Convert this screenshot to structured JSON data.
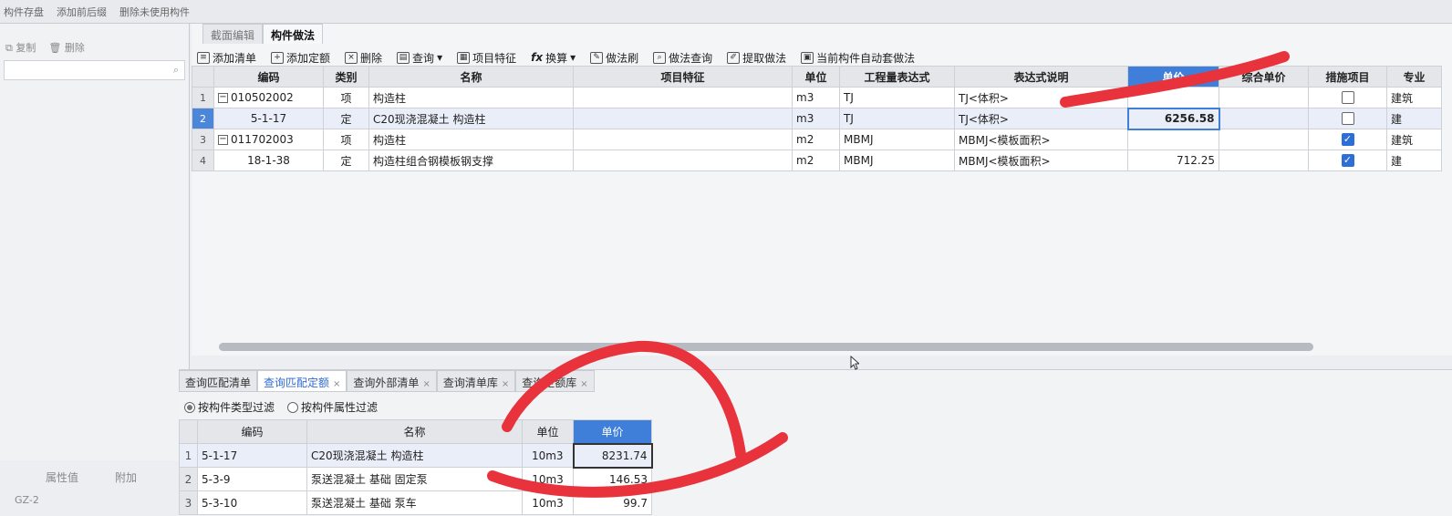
{
  "topbar": {
    "items": [
      "构件存盘",
      "添加前后缀",
      "删除未使用构件"
    ]
  },
  "left_panel": {
    "copy_label": "复制",
    "delete_label": "删除",
    "bottom_labels": [
      "属性值",
      "附加"
    ],
    "bottom_item": "GZ-2"
  },
  "editor": {
    "tabs": [
      "截面编辑",
      "构件做法"
    ],
    "toolbar": [
      "添加清单",
      "添加定额",
      "删除",
      "查询",
      "项目特征",
      "换算",
      "做法刷",
      "做法查询",
      "提取做法",
      "当前构件自动套做法"
    ],
    "columns": [
      "编码",
      "类别",
      "名称",
      "项目特征",
      "单位",
      "工程量表达式",
      "表达式说明",
      "单价",
      "综合单价",
      "措施项目",
      "专业"
    ],
    "rows": [
      {
        "num": "1",
        "code": "010502002",
        "type": "项",
        "name": "构造柱",
        "feature": "",
        "unit": "m3",
        "expr": "TJ",
        "desc": "TJ<体积>",
        "price": "",
        "comp": "",
        "measure": false,
        "major": "建筑"
      },
      {
        "num": "2",
        "code": "5-1-17",
        "type": "定",
        "name": "C20现浇混凝土 构造柱",
        "feature": "",
        "unit": "m3",
        "expr": "TJ",
        "desc": "TJ<体积>",
        "price": "6256.58",
        "comp": "",
        "measure": false,
        "major": "建"
      },
      {
        "num": "3",
        "code": "011702003",
        "type": "项",
        "name": "构造柱",
        "feature": "",
        "unit": "m2",
        "expr": "MBMJ",
        "desc": "MBMJ<模板面积>",
        "price": "",
        "comp": "",
        "measure": true,
        "major": "建筑"
      },
      {
        "num": "4",
        "code": "18-1-38",
        "type": "定",
        "name": "构造柱组合钢模板钢支撑",
        "feature": "",
        "unit": "m2",
        "expr": "MBMJ",
        "desc": "MBMJ<模板面积>",
        "price": "712.25",
        "comp": "",
        "measure": true,
        "major": "建"
      }
    ]
  },
  "bottom": {
    "tabs": [
      "查询匹配清单",
      "查询匹配定额",
      "查询外部清单",
      "查询清单库",
      "查询定额库"
    ],
    "filters": [
      "按构件类型过滤",
      "按构件属性过滤"
    ],
    "columns": [
      "编码",
      "名称",
      "单位",
      "单价"
    ],
    "rows": [
      {
        "num": "1",
        "code": "5-1-17",
        "name": "C20现浇混凝土 构造柱",
        "unit": "10m3",
        "price": "8231.74"
      },
      {
        "num": "2",
        "code": "5-3-9",
        "name": "泵送混凝土 基础 固定泵",
        "unit": "10m3",
        "price": "146.53"
      },
      {
        "num": "3",
        "code": "5-3-10",
        "name": "泵送混凝土 基础 泵车",
        "unit": "10m3",
        "price": "99.7"
      }
    ]
  },
  "colors": {
    "accent": "#3f7fd9",
    "annotation": "#e8323c"
  }
}
